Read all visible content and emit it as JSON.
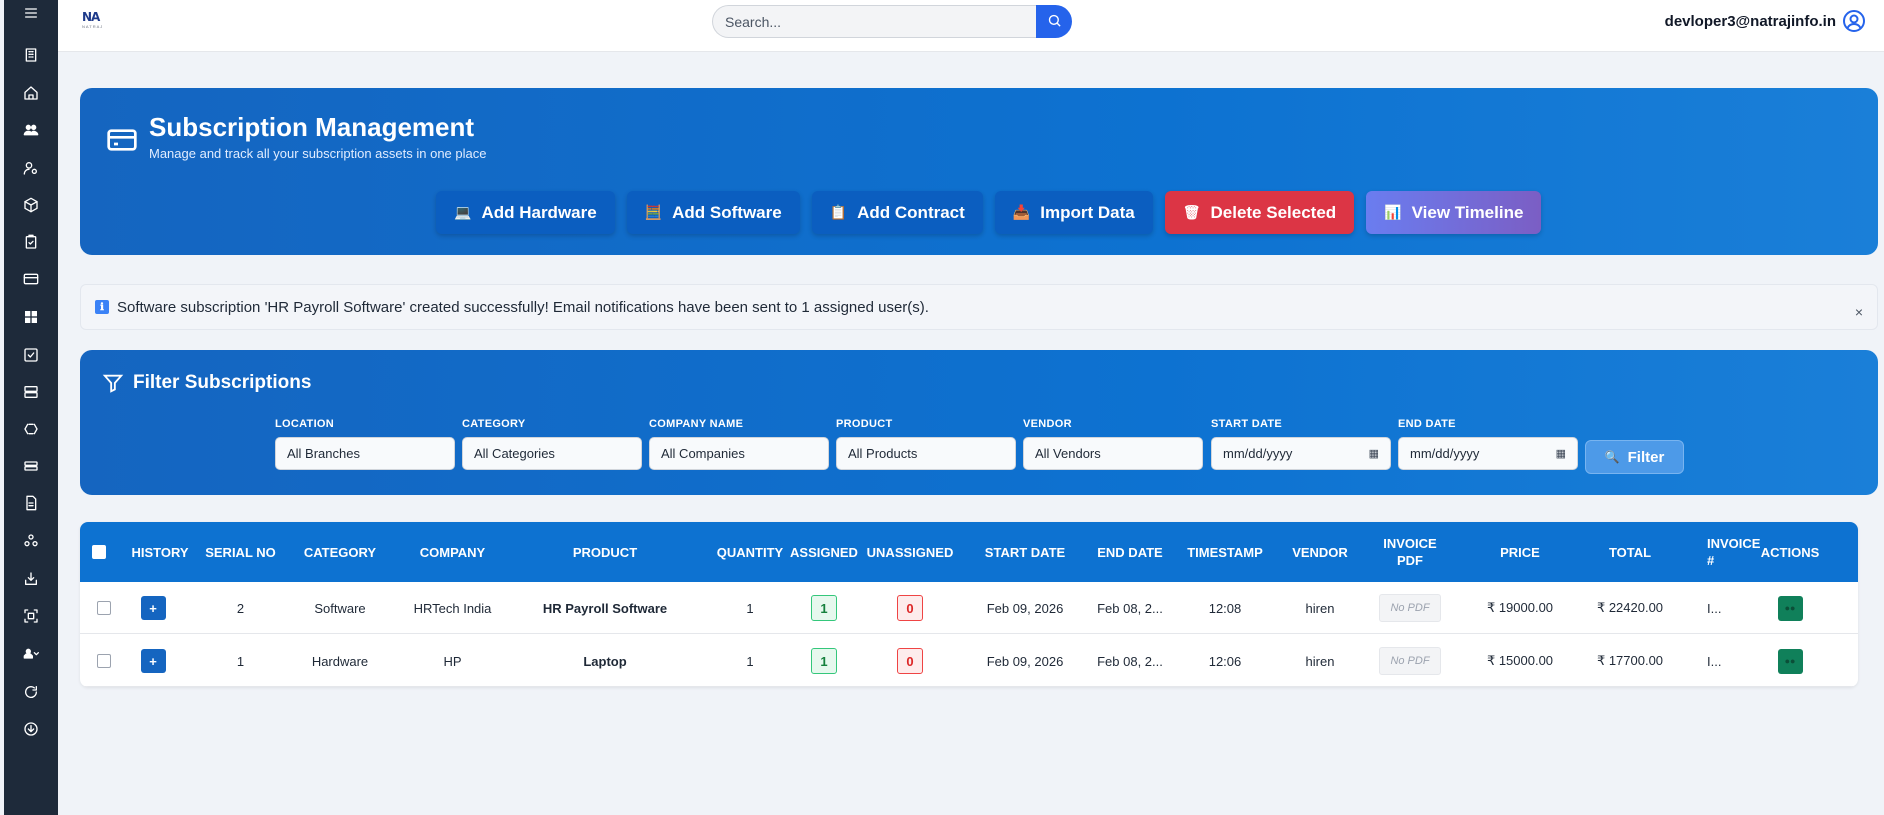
{
  "sidebar": {
    "icons": [
      "menu-icon",
      "building-icon",
      "home-icon",
      "users-icon",
      "user-settings-icon",
      "box-icon",
      "clipboard-icon",
      "credit-card-icon",
      "dashboard-icon",
      "checkbox-icon",
      "server-icon",
      "recycle-icon",
      "storage-icon",
      "document-icon",
      "cluster-icon",
      "download-tray-icon",
      "scan-icon",
      "people-dropdown-icon",
      "refresh-icon",
      "download-circle-icon"
    ]
  },
  "topbar": {
    "search_placeholder": "Search...",
    "user_email": "devloper3@natrajinfo.in",
    "logo_top": "NA",
    "logo_bottom": "NATRAJ"
  },
  "hero": {
    "title": "Subscription Management",
    "subtitle": "Manage and track all your subscription assets in one place",
    "buttons": [
      {
        "label": "Add Hardware",
        "glyph": "💻"
      },
      {
        "label": "Add Software",
        "glyph": "🧮"
      },
      {
        "label": "Add Contract",
        "glyph": "📋"
      },
      {
        "label": "Import Data",
        "glyph": "📥"
      },
      {
        "label": "Delete Selected",
        "glyph": "🗑"
      },
      {
        "label": "View Timeline",
        "glyph": "📊"
      }
    ]
  },
  "alert": {
    "icon": "ℹ",
    "message": "Software subscription 'HR Payroll Software' created successfully! Email notifications have been sent to 1 assigned user(s).",
    "close": "×"
  },
  "filter": {
    "title": "Filter Subscriptions",
    "fields": [
      {
        "label": "LOCATION",
        "value": "All Branches"
      },
      {
        "label": "CATEGORY",
        "value": "All Categories"
      },
      {
        "label": "COMPANY NAME",
        "value": "All Companies"
      },
      {
        "label": "PRODUCT",
        "value": "All Products"
      },
      {
        "label": "VENDOR",
        "value": "All Vendors"
      },
      {
        "label": "START DATE",
        "value": "mm/dd/yyyy"
      },
      {
        "label": "END DATE",
        "value": "mm/dd/yyyy"
      }
    ],
    "button_label": "Filter",
    "button_glyph": "🔍"
  },
  "table": {
    "headers": [
      "HISTORY",
      "SERIAL NO",
      "CATEGORY",
      "COMPANY",
      "PRODUCT",
      "QUANTITY",
      "ASSIGNED",
      "UNASSIGNED",
      "START DATE",
      "END DATE",
      "TIMESTAMP",
      "VENDOR",
      "INVOICE PDF",
      "PRICE",
      "TOTAL",
      "INVOICE #",
      "ACTIONS"
    ],
    "history_glyph": "+",
    "rows": [
      {
        "serial": "2",
        "category": "Software",
        "company": "HRTech India",
        "product": "HR Payroll Software",
        "quantity": "1",
        "assigned": "1",
        "unassigned": "0",
        "start": "Feb 09, 2026",
        "end": "Feb 08, 2...",
        "timestamp": "12:08",
        "vendor": "hiren",
        "pdf": "No PDF",
        "price": "₹ 19000.00",
        "total": "₹ 22420.00",
        "invoice": "I..."
      },
      {
        "serial": "1",
        "category": "Hardware",
        "company": "HP",
        "product": "Laptop",
        "quantity": "1",
        "assigned": "1",
        "unassigned": "0",
        "start": "Feb 09, 2026",
        "end": "Feb 08, 2...",
        "timestamp": "12:06",
        "vendor": "hiren",
        "pdf": "No PDF",
        "price": "₹ 15000.00",
        "total": "₹ 17700.00",
        "invoice": "I..."
      }
    ]
  }
}
